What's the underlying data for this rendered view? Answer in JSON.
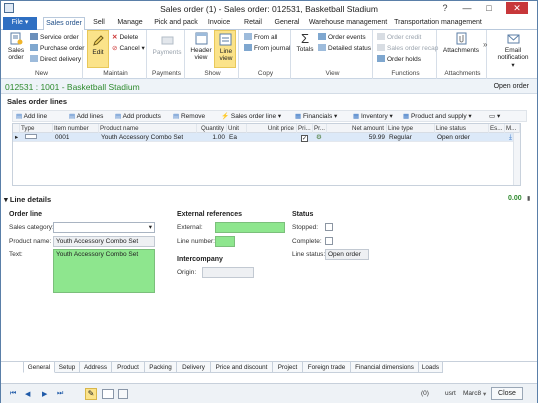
{
  "window": {
    "title": "Sales order (1) - Sales order: 012531, Basketball Stadium",
    "controls": {
      "help": "?",
      "minimize": "—",
      "maximize": "□",
      "close": "✕"
    }
  },
  "ribbon_tabs": [
    {
      "label": "File"
    },
    {
      "label": "Sales order"
    },
    {
      "label": "Sell"
    },
    {
      "label": "Manage"
    },
    {
      "label": "Pick and pack"
    },
    {
      "label": "Invoice"
    },
    {
      "label": "Retail"
    },
    {
      "label": "General"
    },
    {
      "label": "Warehouse management"
    },
    {
      "label": "Transportation management"
    }
  ],
  "ribbon": {
    "new": {
      "group_label": "New",
      "sales_order": "Sales order",
      "service_order": "Service order",
      "purchase_order": "Purchase order",
      "direct_delivery": "Direct delivery"
    },
    "maintain": {
      "group_label": "Maintain",
      "edit": "Edit",
      "delete": "Delete",
      "cancel": "Cancel"
    },
    "payments": {
      "group_label": "Payments",
      "payments": "Payments"
    },
    "show": {
      "group_label": "Show",
      "header_view": "Header view",
      "line_view": "Line view"
    },
    "copy": {
      "group_label": "Copy",
      "from_all": "From all",
      "from_journal": "From journal"
    },
    "view": {
      "group_label": "View",
      "totals": "Totals",
      "order_events": "Order events",
      "detailed_status": "Detailed status"
    },
    "functions": {
      "group_label": "Functions",
      "order_credit": "Order credit",
      "sales_order_recap": "Sales order recap",
      "order_holds": "Order holds"
    },
    "attachments": {
      "group_label": "Attachments",
      "attachments": "Attachments"
    },
    "email": {
      "label": "Email notification"
    }
  },
  "caption": {
    "title": "012531 : 1001 - Basketball Stadium",
    "status": "Open order"
  },
  "sales_order_lines": {
    "header": "Sales order lines",
    "toolbar": {
      "add_line": "Add line",
      "add_lines": "Add lines",
      "add_products": "Add products",
      "remove": "Remove",
      "sales_order_line": "Sales order line",
      "financials": "Financials",
      "inventory": "Inventory",
      "product_and_supply": "Product and supply"
    },
    "columns": [
      "Type",
      "Item number",
      "Product name",
      "Quantity",
      "Unit",
      "Unit price",
      "Pri...",
      "Pr...",
      "Net amount",
      "Line type",
      "Line status",
      "Es...",
      "M..."
    ],
    "rows": [
      {
        "item_number": "0001",
        "product_name": "Youth Accessory Combo Set",
        "quantity": "1.00",
        "unit": "Ea",
        "unit_price": "",
        "net_amount": "59.99",
        "line_type": "Regular",
        "line_status": "Open order"
      }
    ]
  },
  "line_details": {
    "header": "Line details",
    "amount": "0.00",
    "order_line": {
      "title": "Order line",
      "sales_category_label": "Sales category:",
      "sales_category_value": "",
      "product_name_label": "Product name:",
      "product_name_value": "Youth Accessory Combo Set",
      "text_label": "Text:",
      "text_value": "Youth Accessory Combo Set"
    },
    "external_references": {
      "title": "External references",
      "external_label": "External:",
      "line_number_label": "Line number:"
    },
    "intercompany": {
      "title": "Intercompany",
      "origin_label": "Origin:"
    },
    "status": {
      "title": "Status",
      "stopped_label": "Stopped:",
      "complete_label": "Complete:",
      "line_status_label": "Line status:",
      "line_status_value": "Open order"
    }
  },
  "detail_tabs": [
    "General",
    "Setup",
    "Address",
    "Product",
    "Packing",
    "Delivery",
    "Price and discount",
    "Project",
    "Foreign trade",
    "Financial dimensions",
    "Loads"
  ],
  "status_bar": {
    "nav": [
      "⏮",
      "◀",
      "▶",
      "⏭"
    ],
    "count": "(0)",
    "user": "usrt",
    "company": "Marc8",
    "close": "Close"
  },
  "colors": {
    "accent": "#2f6fc2",
    "green_field": "#8ee68e",
    "caption_green": "#2d8a2d"
  }
}
